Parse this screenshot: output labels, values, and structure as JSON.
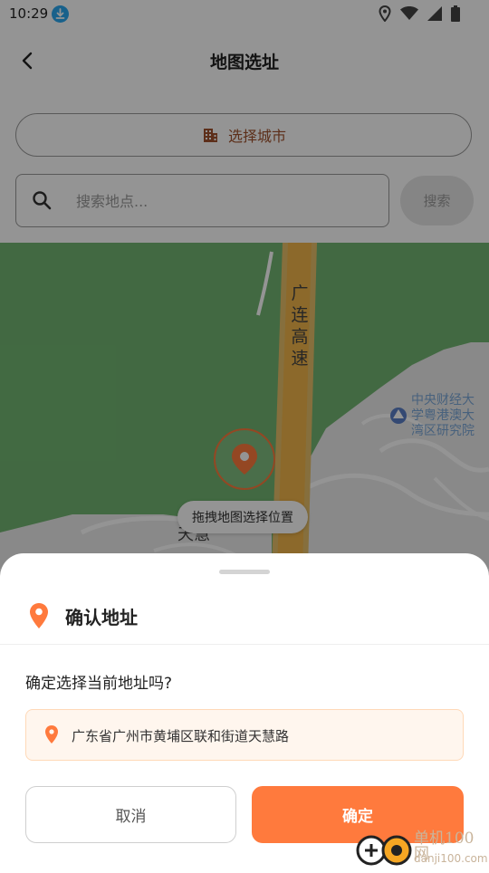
{
  "status_bar": {
    "time": "10:29",
    "icons": [
      "download-icon",
      "location-icon",
      "wifi-icon",
      "signal-icon",
      "battery-icon"
    ]
  },
  "header": {
    "title": "地图选址",
    "back_icon": "chevron-left-icon"
  },
  "city_button": {
    "label": "选择城市",
    "icon": "building-icon"
  },
  "search": {
    "placeholder": "搜索地点...",
    "button_label": "搜索"
  },
  "map": {
    "road_label": "广连高速",
    "poi_label": "中央财经大学粤港澳大湾区研究院",
    "poi_lines": [
      "中央财经大",
      "学粤港澳大",
      "湾区研究院"
    ],
    "partial_label": "天慧",
    "hint": "拖拽地图选择位置",
    "center_marker_icon": "location-pin-icon"
  },
  "sheet": {
    "title": "确认地址",
    "question": "确定选择当前地址吗?",
    "address": "广东省广州市黄埔区联和街道天慧路",
    "cancel_label": "取消",
    "confirm_label": "确定"
  },
  "watermark": {
    "name": "单机100网",
    "url": "danji100.com"
  },
  "colors": {
    "accent": "#ff7a3d",
    "map_green": "#72b672",
    "road": "#f1b54a",
    "city_icon": "#a0522d"
  }
}
